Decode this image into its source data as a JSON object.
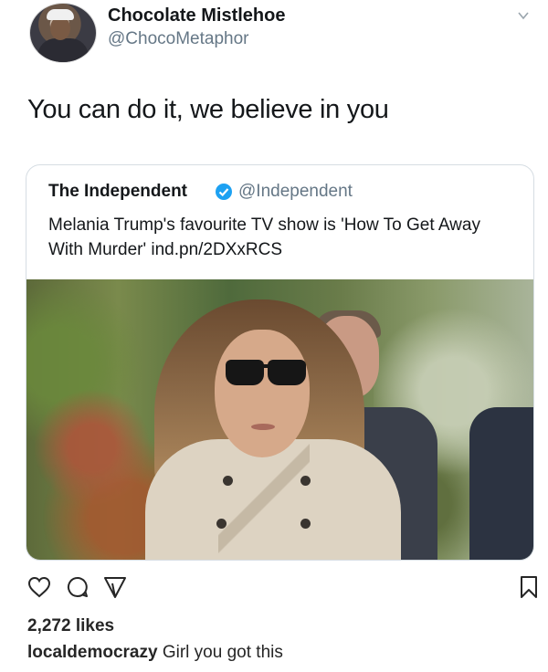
{
  "tweet": {
    "author": {
      "display_name": "Chocolate Mistlehoe",
      "handle": "@ChocoMetaphor"
    },
    "text": "You can do it, we believe in you"
  },
  "quoted_tweet": {
    "author": {
      "display_name": "The Independent",
      "handle": "@Independent",
      "verified": true
    },
    "text": "Melania Trump's favourite TV show is 'How To Get Away With Murder' ind.pn/2DXxRCS"
  },
  "instagram": {
    "likes": "2,272 likes",
    "caption_user": "localdemocrazy",
    "caption_text": "Girl you got this"
  },
  "icons": [
    "chevron-down-icon",
    "verified-icon",
    "heart-icon",
    "comment-icon",
    "share-icon",
    "bookmark-icon"
  ],
  "colors": {
    "verified_blue": "#1da1f2",
    "handle_gray": "#657786",
    "text_dark": "#14171a"
  }
}
